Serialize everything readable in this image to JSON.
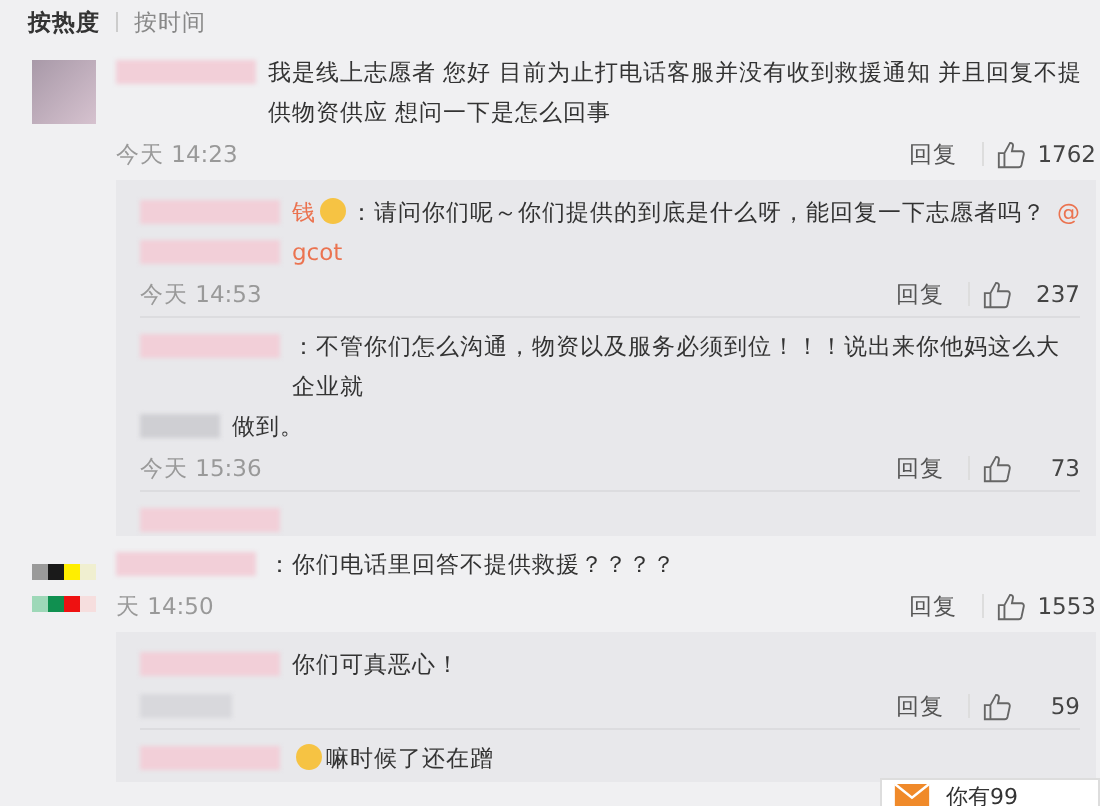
{
  "sort_tabs": [
    {
      "label": "按热度",
      "selected": true
    },
    {
      "label": "按时间",
      "selected": false
    }
  ],
  "comments": [
    {
      "kind": "plain",
      "text": "我是线上志愿者 您好 目前为止打电话客服并没有收到救援通知 并且回复不提供物资供应 想问一下是怎么回事",
      "time": "今天 14:23",
      "reply_label": "回复",
      "likes": "1762",
      "replies": [
        {
          "kind": "reply",
          "name_tail": "钱",
          "emoji": true,
          "text": "：请问你们呢～你们提供的到底是什么呀，能回复一下志愿者吗？",
          "mention": "@",
          "mention_tail": "gcot",
          "time": "今天 14:53",
          "reply_label": "回复",
          "likes": "237"
        },
        {
          "kind": "reply",
          "emoji": false,
          "text": "：不管你们怎么沟通，物资以及服务必须到位！！！说出来你他妈这么大企业就",
          "text2": "做到。",
          "time": "今天 15:36",
          "reply_label": "回复",
          "likes": "73"
        },
        {
          "kind": "blurred"
        }
      ]
    },
    {
      "kind": "mosaic",
      "text": "：你们电话里回答不提供救援？？？？",
      "time": "天 14:50",
      "reply_label": "回复",
      "likes": "1553",
      "replies": [
        {
          "kind": "reply",
          "emoji": false,
          "text": "你们可真恶心！",
          "reply_label": "回复",
          "likes": "59"
        },
        {
          "kind": "reply",
          "emoji": true,
          "text": "嘛时候了还在蹭"
        }
      ]
    }
  ],
  "notice": {
    "text": "你有99"
  }
}
